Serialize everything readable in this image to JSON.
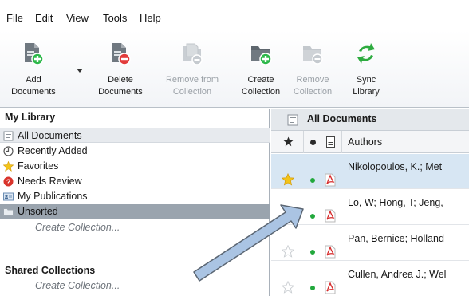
{
  "menu": [
    "File",
    "Edit",
    "View",
    "Tools",
    "Help"
  ],
  "toolbar": {
    "add": "Add\nDocuments",
    "delete": "Delete\nDocuments",
    "remove_from": "Remove from\nCollection",
    "create": "Create\nCollection",
    "remove": "Remove\nCollection",
    "sync": "Sync\nLibrary"
  },
  "library": {
    "header": "My Library",
    "items": [
      {
        "label": "All Documents",
        "icon": "documents-icon"
      },
      {
        "label": "Recently Added",
        "icon": "clock-icon"
      },
      {
        "label": "Favorites",
        "icon": "star-icon"
      },
      {
        "label": "Needs Review",
        "icon": "question-icon"
      },
      {
        "label": "My Publications",
        "icon": "profile-card-icon"
      },
      {
        "label": "Unsorted",
        "icon": "folder-icon"
      }
    ],
    "create_collection": "Create Collection...",
    "shared_header": "Shared Collections",
    "shared_create": "Create Collection..."
  },
  "documents": {
    "title": "All Documents",
    "column_authors": "Authors",
    "rows": [
      {
        "author": "Nikolopoulos, K.; Met",
        "favorite": true,
        "selected": true
      },
      {
        "author": "Lo, W; Hong, T; Jeng,",
        "favorite": false,
        "selected": false
      },
      {
        "author": "Pan, Bernice; Holland",
        "favorite": false,
        "selected": false
      },
      {
        "author": "Cullen, Andrea J.; Wel",
        "favorite": false,
        "selected": false
      }
    ]
  },
  "colors": {
    "accent_green": "#22a83c",
    "selected_row": "#d7e6f3",
    "unsorted_selected": "#9aa4ae",
    "arrow_fill": "#aac4e3"
  }
}
